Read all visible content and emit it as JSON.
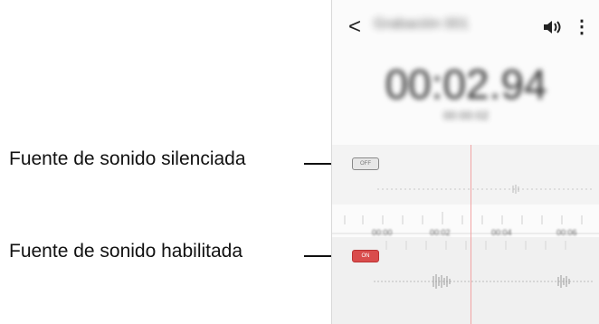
{
  "callouts": {
    "muted_label": "Fuente de sonido silenciada",
    "enabled_label": "Fuente de sonido habilitada"
  },
  "app": {
    "back_glyph": "<",
    "title": "Grabación 001",
    "more_glyph": "⋮",
    "timer": "00:02.94",
    "sub_time": "00:00:02",
    "mute_button_label": "OFF",
    "enable_button_label": "ON",
    "ruler_labels": [
      "00:00",
      "00:02",
      "00:04",
      "00:06"
    ]
  },
  "colors": {
    "playhead": "#f1a3a3",
    "enabled_button": "#d94c4c"
  }
}
